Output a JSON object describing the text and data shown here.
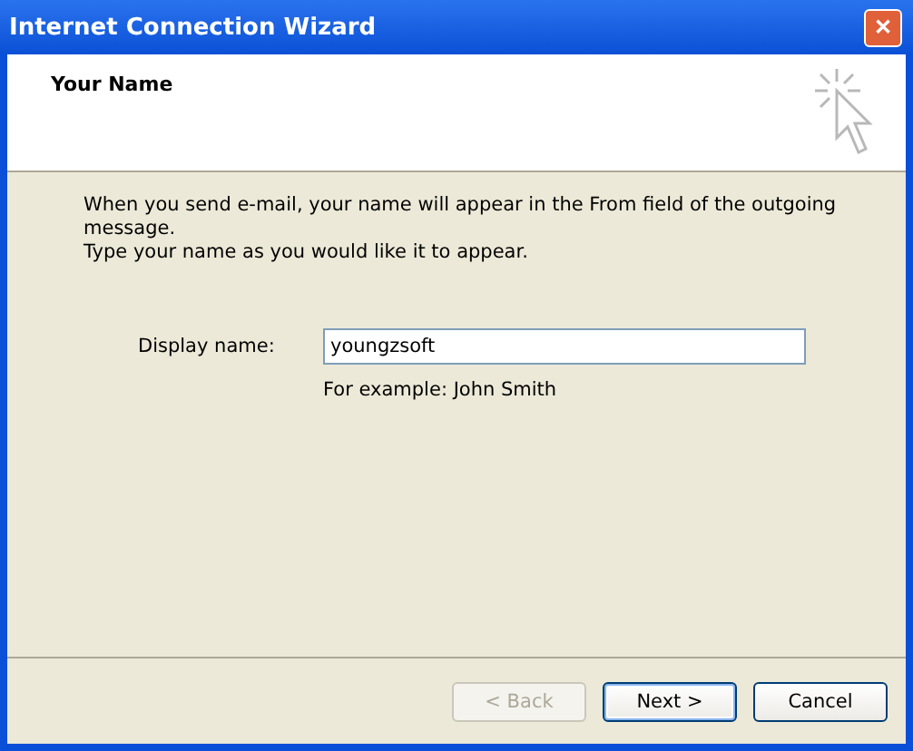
{
  "window": {
    "title": "Internet Connection Wizard",
    "close": "✕"
  },
  "header": {
    "title": "Your Name"
  },
  "intro": "When you send e-mail, your name will appear in the From field of the outgoing message.\nType your name as you would like it to appear.",
  "field": {
    "label": "Display name:",
    "value": "youngzsoft",
    "hint": "For example: John Smith"
  },
  "buttons": [
    {
      "label": "< Back",
      "disabled": true,
      "default": false
    },
    {
      "label": "Next >",
      "disabled": false,
      "default": true
    },
    {
      "label": "Cancel",
      "disabled": false,
      "default": false
    }
  ]
}
